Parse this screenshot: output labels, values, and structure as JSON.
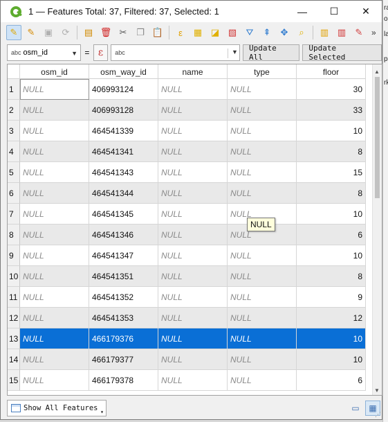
{
  "window": {
    "title": "1 — Features Total: 37, Filtered: 37, Selected: 1",
    "minimize": "—",
    "maximize": "☐",
    "close": "✕"
  },
  "toolbar": {
    "icons": [
      {
        "name": "toggle-editing-icon",
        "glyph": "✎",
        "color": "#e0a800",
        "active": true
      },
      {
        "name": "multi-edit-icon",
        "glyph": "✎",
        "color": "#d48a00"
      },
      {
        "name": "save-edits-icon",
        "glyph": "▣",
        "color": "#b0b0b0"
      },
      {
        "name": "reload-icon",
        "glyph": "⟳",
        "color": "#b0b0b0"
      },
      {
        "name": "add-feature-icon",
        "glyph": "▤",
        "color": "#d08a00"
      },
      {
        "name": "delete-feature-icon",
        "glyph": "🗑",
        "color": "#d02020"
      },
      {
        "name": "cut-icon",
        "glyph": "✂",
        "color": "#555"
      },
      {
        "name": "copy-icon",
        "glyph": "❐",
        "color": "#888"
      },
      {
        "name": "paste-icon",
        "glyph": "📋",
        "color": "#888"
      },
      {
        "name": "select-by-expression-icon",
        "glyph": "ε",
        "color": "#e0a000"
      },
      {
        "name": "select-all-icon",
        "glyph": "▦",
        "color": "#e0b000"
      },
      {
        "name": "invert-selection-icon",
        "glyph": "◪",
        "color": "#e0b000"
      },
      {
        "name": "deselect-all-icon",
        "glyph": "▧",
        "color": "#d03030"
      },
      {
        "name": "filter-icon",
        "glyph": "⛛",
        "color": "#2e7bcf"
      },
      {
        "name": "move-selection-to-top-icon",
        "glyph": "⇞",
        "color": "#2e7bcf"
      },
      {
        "name": "pan-to-selected-icon",
        "glyph": "✥",
        "color": "#2e7bcf"
      },
      {
        "name": "zoom-to-selected-icon",
        "glyph": "⌕",
        "color": "#e0b000"
      },
      {
        "name": "new-field-icon",
        "glyph": "▥",
        "color": "#e0a000"
      },
      {
        "name": "delete-field-icon",
        "glyph": "▥",
        "color": "#d03030"
      },
      {
        "name": "field-calculator-icon",
        "glyph": "✎",
        "color": "#d04040"
      }
    ],
    "overflow": "»"
  },
  "formula": {
    "field_select": "osm_id",
    "field_type_badge": "abc",
    "equals": "=",
    "expression_button": "ε",
    "value_badge": "abc",
    "value": "",
    "update_all": "Update All",
    "update_selected": "Update Selected"
  },
  "table": {
    "columns": [
      "osm_id",
      "osm_way_id",
      "name",
      "type",
      "floor"
    ],
    "rows": [
      {
        "n": "1",
        "osm_id": "NULL",
        "osm_way_id": "406993124",
        "name": "NULL",
        "type": "NULL",
        "floor": "30"
      },
      {
        "n": "2",
        "osm_id": "NULL",
        "osm_way_id": "406993128",
        "name": "NULL",
        "type": "NULL",
        "floor": "33"
      },
      {
        "n": "3",
        "osm_id": "NULL",
        "osm_way_id": "464541339",
        "name": "NULL",
        "type": "NULL",
        "floor": "10"
      },
      {
        "n": "4",
        "osm_id": "NULL",
        "osm_way_id": "464541341",
        "name": "NULL",
        "type": "NULL",
        "floor": "8"
      },
      {
        "n": "5",
        "osm_id": "NULL",
        "osm_way_id": "464541343",
        "name": "NULL",
        "type": "NULL",
        "floor": "15"
      },
      {
        "n": "6",
        "osm_id": "NULL",
        "osm_way_id": "464541344",
        "name": "NULL",
        "type": "NULL",
        "floor": "8"
      },
      {
        "n": "7",
        "osm_id": "NULL",
        "osm_way_id": "464541345",
        "name": "NULL",
        "type": "NULL",
        "floor": "10"
      },
      {
        "n": "8",
        "osm_id": "NULL",
        "osm_way_id": "464541346",
        "name": "NULL",
        "type": "NULL",
        "floor": "6"
      },
      {
        "n": "9",
        "osm_id": "NULL",
        "osm_way_id": "464541347",
        "name": "NULL",
        "type": "NULL",
        "floor": "10"
      },
      {
        "n": "10",
        "osm_id": "NULL",
        "osm_way_id": "464541351",
        "name": "NULL",
        "type": "NULL",
        "floor": "8"
      },
      {
        "n": "11",
        "osm_id": "NULL",
        "osm_way_id": "464541352",
        "name": "NULL",
        "type": "NULL",
        "floor": "9"
      },
      {
        "n": "12",
        "osm_id": "NULL",
        "osm_way_id": "464541353",
        "name": "NULL",
        "type": "NULL",
        "floor": "12"
      },
      {
        "n": "13",
        "osm_id": "NULL",
        "osm_way_id": "466179376",
        "name": "NULL",
        "type": "NULL",
        "floor": "10"
      },
      {
        "n": "14",
        "osm_id": "NULL",
        "osm_way_id": "466179377",
        "name": "NULL",
        "type": "NULL",
        "floor": "10"
      },
      {
        "n": "15",
        "osm_id": "NULL",
        "osm_way_id": "466179378",
        "name": "NULL",
        "type": "NULL",
        "floor": "6"
      }
    ],
    "selected_row": 13,
    "tooltip": "NULL",
    "selection_color": "#0a6fd6"
  },
  "bottom": {
    "filter_mode": "Show All Features"
  },
  "background_text": [
    "ra",
    "ols",
    "la",
    "pe",
    "rk"
  ]
}
